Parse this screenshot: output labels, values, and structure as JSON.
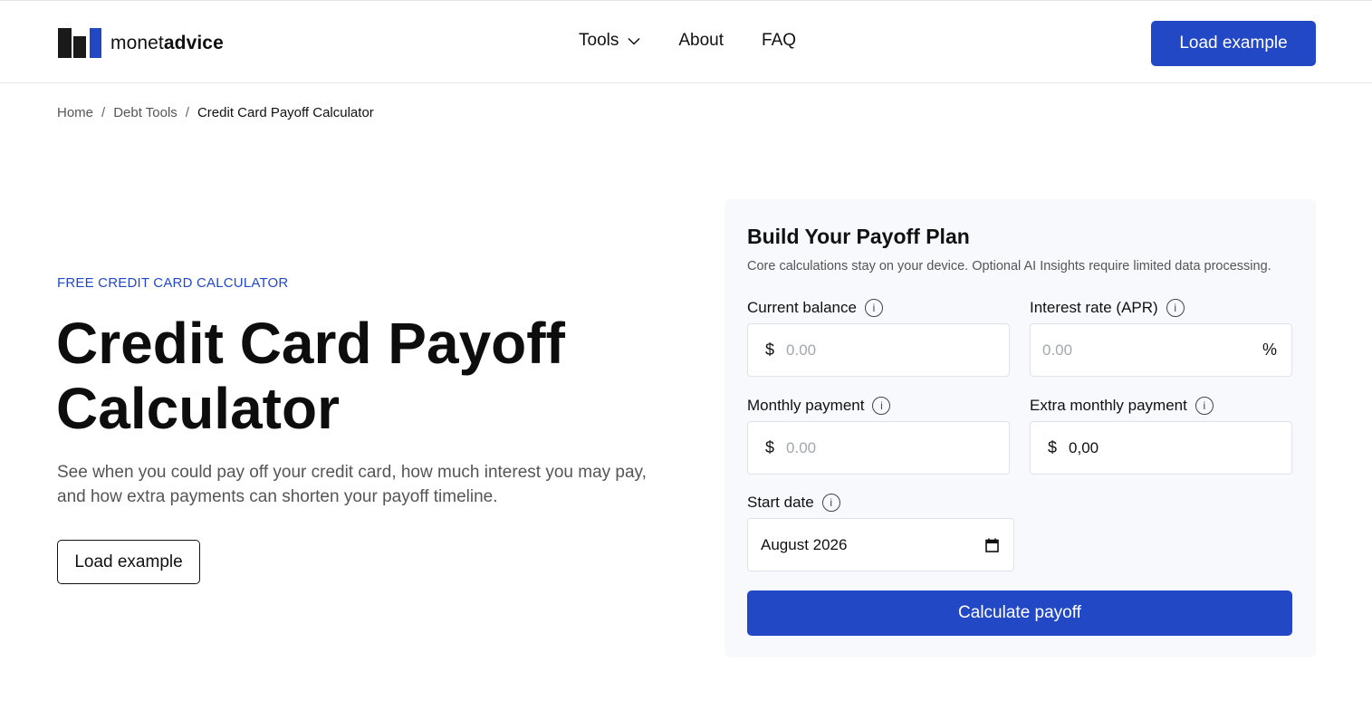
{
  "header": {
    "logo": {
      "text_regular": "monet",
      "text_bold": "advice"
    },
    "nav": [
      {
        "label": "Tools"
      },
      {
        "label": "About"
      },
      {
        "label": "FAQ"
      }
    ],
    "cta_label": "Load example"
  },
  "breadcrumb": {
    "items": [
      "Home",
      "Debt Tools",
      "Credit Card Payoff Calculator"
    ],
    "separator": "/"
  },
  "hero": {
    "eyebrow": "FREE CREDIT CARD CALCULATOR",
    "title_line1": "Credit Card Payoff",
    "title_line2": "Calculator",
    "description": "See when you could pay off your credit card, how much interest you may pay, and how extra payments can shorten your payoff timeline.",
    "button_label": "Load example"
  },
  "form": {
    "title": "Build Your Payoff Plan",
    "subtitle": "Core calculations stay on your device. Optional AI Insights require limited data processing.",
    "info_glyph": "i",
    "fields": {
      "balance": {
        "label": "Current balance",
        "prefix": "$",
        "placeholder": "0.00"
      },
      "apr": {
        "label": "Interest rate (APR)",
        "suffix": "%",
        "placeholder": "0.00"
      },
      "monthly": {
        "label": "Monthly payment",
        "prefix": "$",
        "placeholder": "0.00"
      },
      "extra": {
        "label": "Extra monthly payment",
        "prefix": "$",
        "value": "0,00"
      },
      "start_date": {
        "label": "Start date",
        "value": "August 2026"
      }
    },
    "submit_label": "Calculate payoff"
  },
  "colors": {
    "accent": "#2348c6",
    "text": "#111111",
    "muted": "#555555",
    "card_bg": "#f8f9fd",
    "border": "#dfe2e8"
  },
  "icons": [
    "logo-icon",
    "chevron-down-icon",
    "info-icon",
    "calendar-icon"
  ]
}
